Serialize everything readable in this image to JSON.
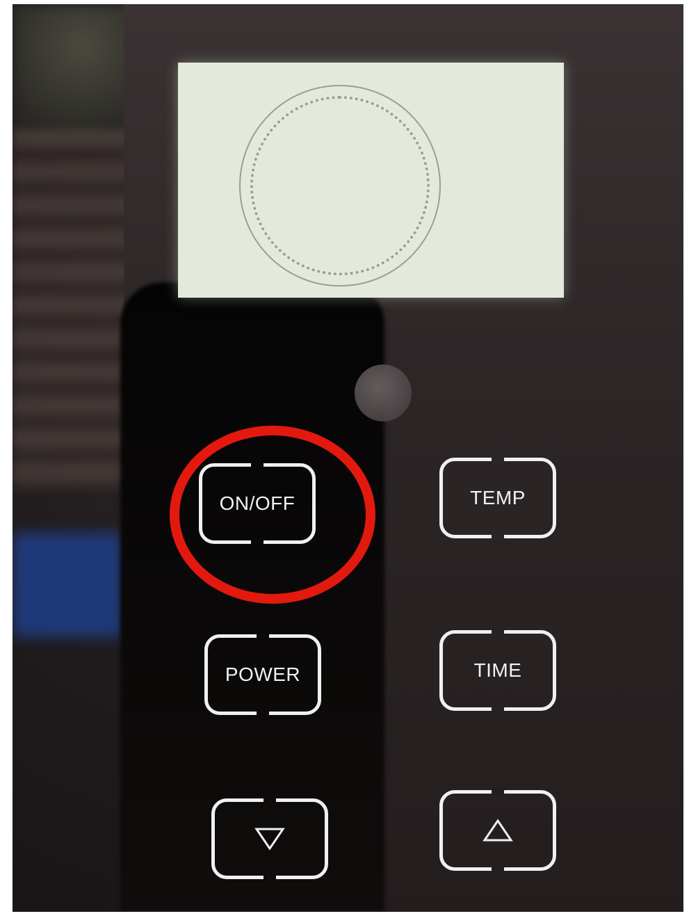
{
  "panel": {
    "buttons": {
      "on_off": "ON/OFF",
      "temp": "TEMP",
      "power": "POWER",
      "time": "TIME",
      "down_icon": "triangle-down-icon",
      "up_icon": "triangle-up-icon"
    },
    "highlight_color": "#e3190f"
  }
}
